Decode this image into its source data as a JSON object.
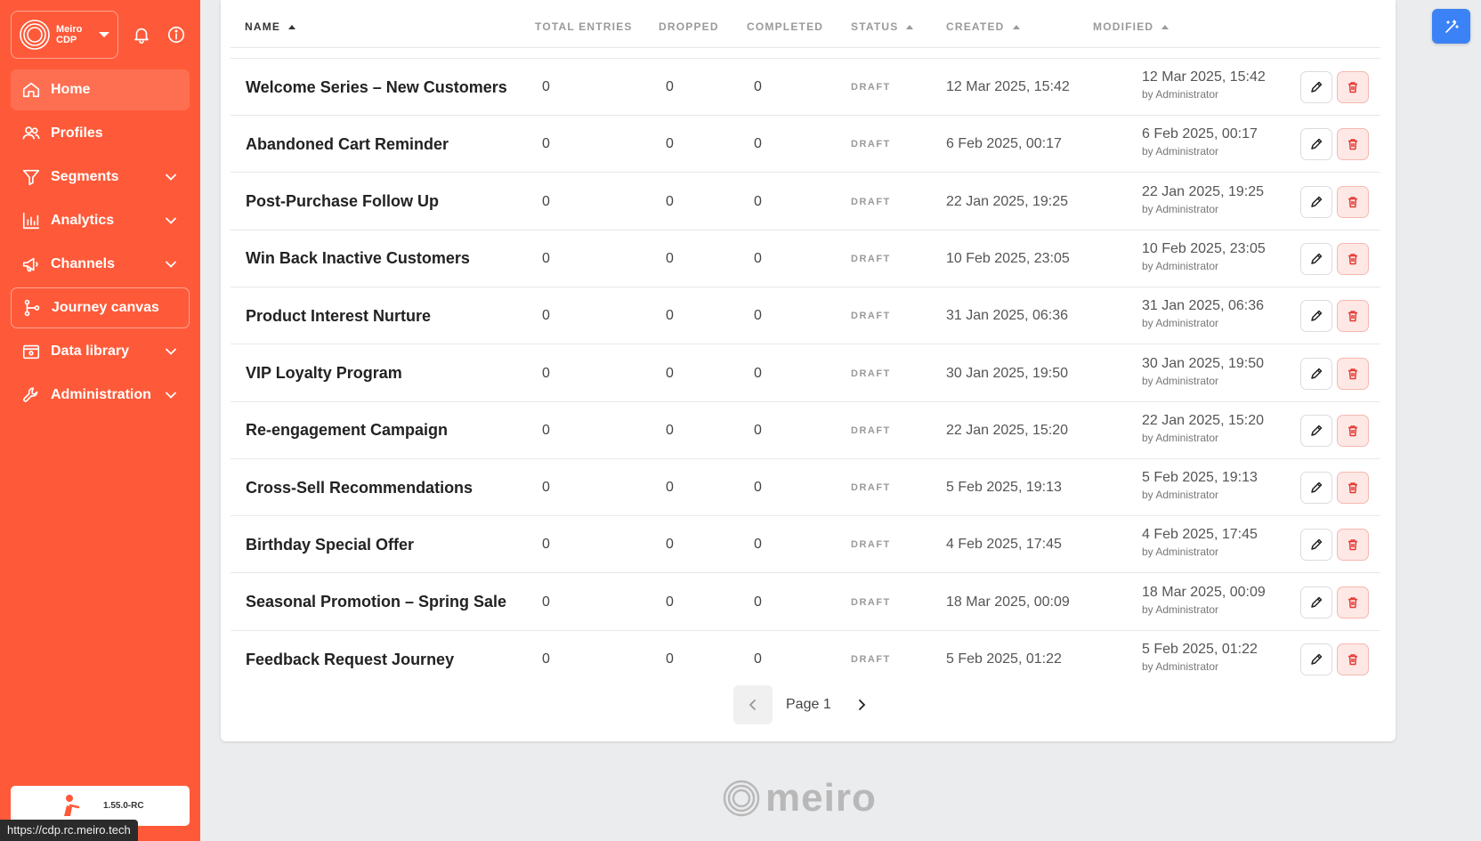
{
  "brand": {
    "name_line1": "Meiro",
    "name_line2": "CDP"
  },
  "sidebar": {
    "items": [
      {
        "label": "Home",
        "icon": "home-icon",
        "active": true,
        "has_caret": false
      },
      {
        "label": "Profiles",
        "icon": "users-icon",
        "active": false,
        "has_caret": false
      },
      {
        "label": "Segments",
        "icon": "filter-icon",
        "active": false,
        "has_caret": true
      },
      {
        "label": "Analytics",
        "icon": "bar-chart-icon",
        "active": false,
        "has_caret": true
      },
      {
        "label": "Channels",
        "icon": "megaphone-icon",
        "active": false,
        "has_caret": true
      },
      {
        "label": "Journey canvas",
        "icon": "journey-icon",
        "active": false,
        "has_caret": false
      },
      {
        "label": "Data library",
        "icon": "book-icon",
        "active": false,
        "has_caret": true
      },
      {
        "label": "Administration",
        "icon": "wrench-icon",
        "active": false,
        "has_caret": true
      }
    ],
    "version": "1.55.0-RC"
  },
  "status_url": "https://cdp.rc.meiro.tech",
  "table": {
    "headers": {
      "name": "NAME",
      "total_entries": "TOTAL ENTRIES",
      "dropped": "DROPPED",
      "completed": "COMPLETED",
      "status": "STATUS",
      "created": "CREATED",
      "modified": "MODIFIED"
    },
    "rows": [
      {
        "name": "Welcome Series – New Customers",
        "total": "0",
        "dropped": "0",
        "completed": "0",
        "status": "DRAFT",
        "created": "12 Mar 2025, 15:42",
        "modified": "12 Mar 2025, 15:42",
        "modified_by": "by Administrator"
      },
      {
        "name": "Abandoned Cart Reminder",
        "total": "0",
        "dropped": "0",
        "completed": "0",
        "status": "DRAFT",
        "created": "6 Feb 2025, 00:17",
        "modified": "6 Feb 2025, 00:17",
        "modified_by": "by Administrator"
      },
      {
        "name": "Post-Purchase Follow Up",
        "total": "0",
        "dropped": "0",
        "completed": "0",
        "status": "DRAFT",
        "created": "22 Jan 2025, 19:25",
        "modified": "22 Jan 2025, 19:25",
        "modified_by": "by Administrator"
      },
      {
        "name": "Win Back Inactive Customers",
        "total": "0",
        "dropped": "0",
        "completed": "0",
        "status": "DRAFT",
        "created": "10 Feb 2025, 23:05",
        "modified": "10 Feb 2025, 23:05",
        "modified_by": "by Administrator"
      },
      {
        "name": "Product Interest Nurture",
        "total": "0",
        "dropped": "0",
        "completed": "0",
        "status": "DRAFT",
        "created": "31 Jan 2025, 06:36",
        "modified": "31 Jan 2025, 06:36",
        "modified_by": "by Administrator"
      },
      {
        "name": "VIP Loyalty Program",
        "total": "0",
        "dropped": "0",
        "completed": "0",
        "status": "DRAFT",
        "created": "30 Jan 2025, 19:50",
        "modified": "30 Jan 2025, 19:50",
        "modified_by": "by Administrator"
      },
      {
        "name": "Re-engagement Campaign",
        "total": "0",
        "dropped": "0",
        "completed": "0",
        "status": "DRAFT",
        "created": "22 Jan 2025, 15:20",
        "modified": "22 Jan 2025, 15:20",
        "modified_by": "by Administrator"
      },
      {
        "name": "Cross-Sell Recommendations",
        "total": "0",
        "dropped": "0",
        "completed": "0",
        "status": "DRAFT",
        "created": "5 Feb 2025, 19:13",
        "modified": "5 Feb 2025, 19:13",
        "modified_by": "by Administrator"
      },
      {
        "name": "Birthday Special Offer",
        "total": "0",
        "dropped": "0",
        "completed": "0",
        "status": "DRAFT",
        "created": "4 Feb 2025, 17:45",
        "modified": "4 Feb 2025, 17:45",
        "modified_by": "by Administrator"
      },
      {
        "name": "Seasonal Promotion – Spring Sale",
        "total": "0",
        "dropped": "0",
        "completed": "0",
        "status": "DRAFT",
        "created": "18 Mar 2025, 00:09",
        "modified": "18 Mar 2025, 00:09",
        "modified_by": "by Administrator"
      },
      {
        "name": "Feedback Request Journey",
        "total": "0",
        "dropped": "0",
        "completed": "0",
        "status": "DRAFT",
        "created": "5 Feb 2025, 01:22",
        "modified": "5 Feb 2025, 01:22",
        "modified_by": "by Administrator"
      }
    ]
  },
  "pagination": {
    "label": "Page 1"
  },
  "footer": {
    "wordmark": "meiro"
  },
  "colors": {
    "sidebar": "#fe5a39",
    "accent_blue": "#3b82f6",
    "delete_bg": "#fde8e5"
  }
}
